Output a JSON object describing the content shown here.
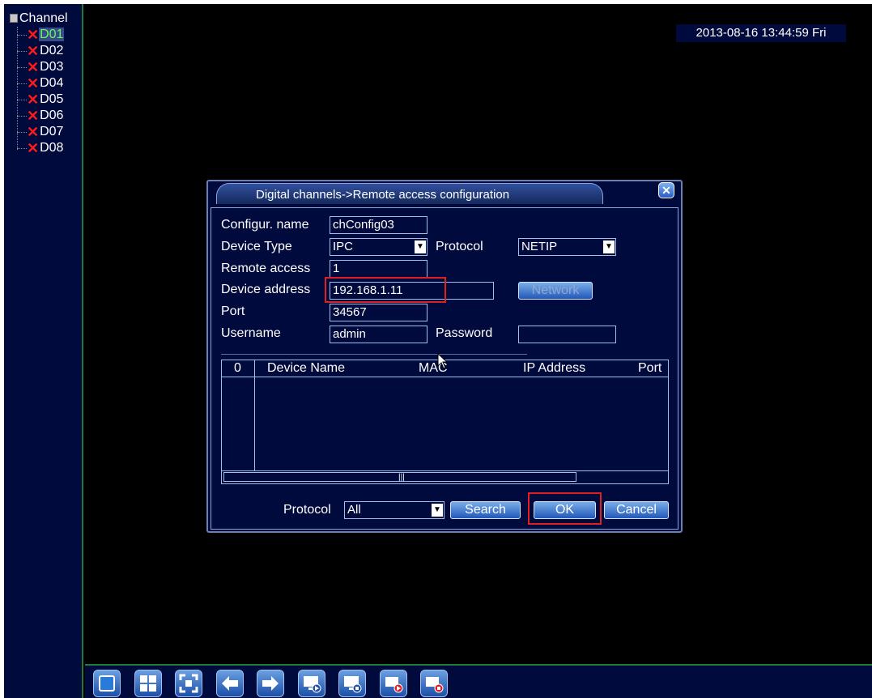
{
  "sidebar": {
    "title": "Channel",
    "channels": [
      {
        "label": "D01",
        "selected": true
      },
      {
        "label": "D02",
        "selected": false
      },
      {
        "label": "D03",
        "selected": false
      },
      {
        "label": "D04",
        "selected": false
      },
      {
        "label": "D05",
        "selected": false
      },
      {
        "label": "D06",
        "selected": false
      },
      {
        "label": "D07",
        "selected": false
      },
      {
        "label": "D08",
        "selected": false
      }
    ]
  },
  "datetime": "2013-08-16 13:44:59 Fri",
  "dialog": {
    "title": "Digital channels->Remote access configuration",
    "labels": {
      "config_name": "Configur. name",
      "device_type": "Device Type",
      "protocol": "Protocol",
      "remote_access": "Remote access",
      "device_address": "Device address",
      "port": "Port",
      "username": "Username",
      "password": "Password"
    },
    "values": {
      "config_name": "chConfig03",
      "device_type": "IPC",
      "protocol": "NETIP",
      "remote_access": "1",
      "device_address": "192.168.1.11",
      "port": "34567",
      "username": "admin",
      "password": ""
    },
    "network_button": "Network",
    "table": {
      "columns": [
        "0",
        "Device Name",
        "MAC",
        "IP Address",
        "Port"
      ],
      "rows": []
    },
    "footer": {
      "protocol_label": "Protocol",
      "protocol_value": "All",
      "search": "Search",
      "ok": "OK",
      "cancel": "Cancel"
    }
  },
  "toolbar": {
    "icons": [
      "single-view-icon",
      "quad-view-icon",
      "fullscreen-icon",
      "previous-icon",
      "next-icon",
      "monitor-play-icon",
      "monitor-stop-icon",
      "record-icon",
      "stop-record-icon"
    ]
  },
  "colors": {
    "panel_bg": "#000a3c",
    "highlight_border": "#e02020",
    "selected_text": "#5dff5d",
    "channel_offline": "#ff1a1a"
  }
}
